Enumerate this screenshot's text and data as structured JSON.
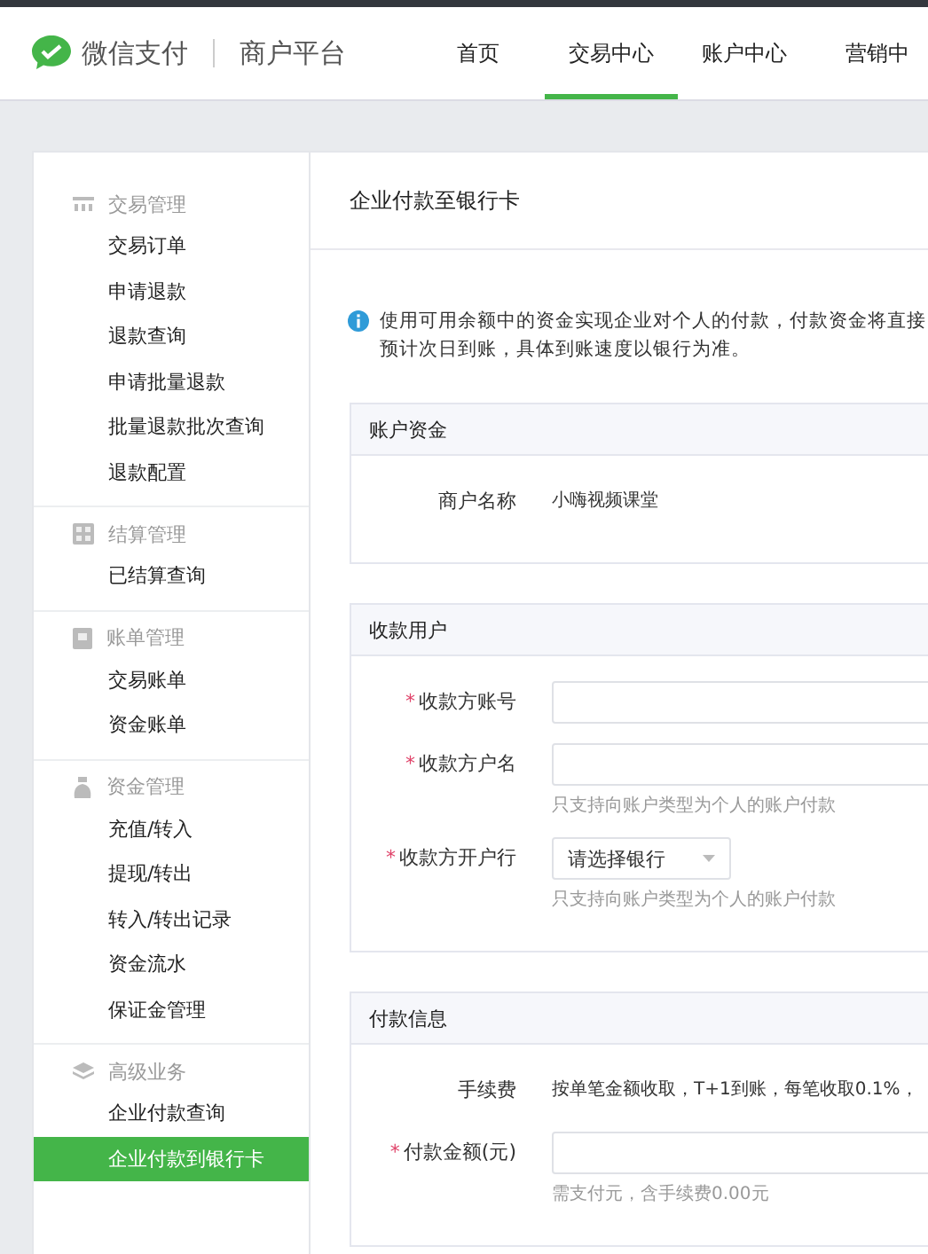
{
  "header": {
    "brand": "微信支付",
    "product": "商户平台",
    "nav": [
      {
        "label": "首页",
        "selected": false
      },
      {
        "label": "交易中心",
        "selected": true
      },
      {
        "label": "账户中心",
        "selected": false
      },
      {
        "label": "营销中",
        "selected": false
      }
    ]
  },
  "sidebar": {
    "groups": [
      {
        "title": "交易管理",
        "items": [
          {
            "label": "交易订单",
            "selected": false
          },
          {
            "label": "申请退款",
            "selected": false
          },
          {
            "label": "退款查询",
            "selected": false
          },
          {
            "label": "申请批量退款",
            "selected": false
          },
          {
            "label": "批量退款批次查询",
            "selected": false
          },
          {
            "label": "退款配置",
            "selected": false
          }
        ]
      },
      {
        "title": "结算管理",
        "items": [
          {
            "label": "已结算查询",
            "selected": false
          }
        ]
      },
      {
        "title": "账单管理",
        "items": [
          {
            "label": "交易账单",
            "selected": false
          },
          {
            "label": "资金账单",
            "selected": false
          }
        ]
      },
      {
        "title": "资金管理",
        "items": [
          {
            "label": "充值/转入",
            "selected": false
          },
          {
            "label": "提现/转出",
            "selected": false
          },
          {
            "label": "转入/转出记录",
            "selected": false
          },
          {
            "label": "资金流水",
            "selected": false
          },
          {
            "label": "保证金管理",
            "selected": false
          }
        ]
      },
      {
        "title": "高级业务",
        "items": [
          {
            "label": "企业付款查询",
            "selected": false
          },
          {
            "label": "企业付款到银行卡",
            "selected": true
          }
        ]
      }
    ]
  },
  "page": {
    "title": "企业付款至银行卡",
    "notice": [
      "使用可用余额中的资金实现企业对个人的付款，付款资金将直接",
      "预计次日到账，具体到账速度以银行为准。"
    ],
    "sections": [
      {
        "title": "账户资金",
        "fields": [
          {
            "kind": "text",
            "label": "商户名称",
            "value": "小嗨视频课堂"
          }
        ]
      },
      {
        "title": "收款用户",
        "fields": [
          {
            "kind": "input",
            "label": "收款方账号",
            "mark": "*"
          },
          {
            "kind": "input",
            "label": "收款方户名",
            "mark": "*",
            "hint": "只支持向账户类型为个人的账户付款"
          },
          {
            "kind": "select",
            "label": "收款方开户行",
            "mark": "*",
            "value": "请选择银行",
            "hint": "只支持向账户类型为个人的账户付款"
          }
        ]
      },
      {
        "title": "付款信息",
        "fields": [
          {
            "kind": "text",
            "label": "手续费",
            "value": "按单笔金额收取，T+1到账，每笔收取0.1%，"
          },
          {
            "kind": "input",
            "label": "付款金额(元)",
            "mark": "*",
            "hint": "需支付元，含手续费0.00元"
          }
        ]
      }
    ]
  }
}
